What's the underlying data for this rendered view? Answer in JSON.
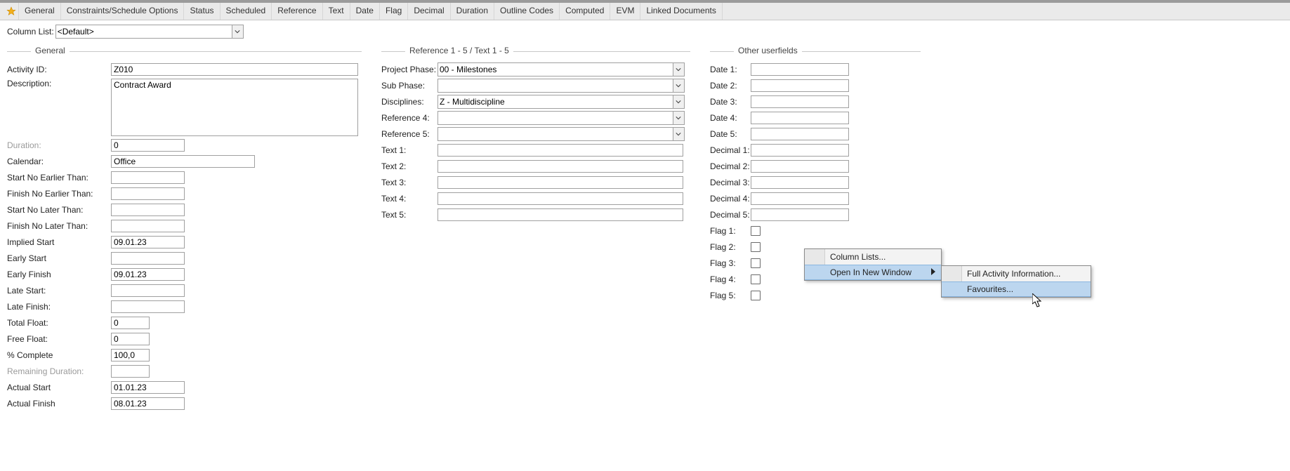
{
  "tabs": [
    "General",
    "Constraints/Schedule Options",
    "Status",
    "Scheduled",
    "Reference",
    "Text",
    "Date",
    "Flag",
    "Decimal",
    "Duration",
    "Outline Codes",
    "Computed",
    "EVM",
    "Linked Documents"
  ],
  "column_list": {
    "label": "Column List:",
    "value": "<Default>"
  },
  "sections": {
    "general": "General",
    "ref": "Reference 1 - 5 / Text 1 - 5",
    "other": "Other userfields"
  },
  "general": {
    "activity_id": {
      "label": "Activity ID:",
      "value": "Z010"
    },
    "description": {
      "label": "Description:",
      "value": "Contract Award"
    },
    "duration": {
      "label": "Duration:",
      "value": "0"
    },
    "calendar": {
      "label": "Calendar:",
      "value": "Office"
    },
    "snet": {
      "label": "Start No Earlier Than:",
      "value": ""
    },
    "fnet": {
      "label": "Finish No  Earlier Than:",
      "value": ""
    },
    "snlt": {
      "label": "Start No Later Than:",
      "value": ""
    },
    "fnlt": {
      "label": "Finish No Later Than:",
      "value": ""
    },
    "imps": {
      "label": "Implied Start",
      "value": "09.01.23"
    },
    "es": {
      "label": "Early Start",
      "value": ""
    },
    "ef": {
      "label": "Early Finish",
      "value": "09.01.23"
    },
    "ls": {
      "label": "Late Start:",
      "value": ""
    },
    "lf": {
      "label": "Late Finish:",
      "value": ""
    },
    "tf": {
      "label": "Total Float:",
      "value": "0"
    },
    "ff": {
      "label": "Free Float:",
      "value": "0"
    },
    "pct": {
      "label": "% Complete",
      "value": "100,0"
    },
    "remd": {
      "label": "Remaining Duration:",
      "value": ""
    },
    "as": {
      "label": "Actual Start",
      "value": "01.01.23"
    },
    "af": {
      "label": "Actual Finish",
      "value": "08.01.23"
    }
  },
  "ref": {
    "phase": {
      "label": "Project Phase:",
      "value": "00 - Milestones"
    },
    "sub": {
      "label": "Sub Phase:",
      "value": ""
    },
    "disc": {
      "label": "Disciplines:",
      "value": "Z - Multidiscipline"
    },
    "r4": {
      "label": "Reference 4:",
      "value": ""
    },
    "r5": {
      "label": "Reference 5:",
      "value": ""
    },
    "t1": {
      "label": "Text 1:",
      "value": ""
    },
    "t2": {
      "label": "Text 2:",
      "value": ""
    },
    "t3": {
      "label": "Text 3:",
      "value": ""
    },
    "t4": {
      "label": "Text 4:",
      "value": ""
    },
    "t5": {
      "label": "Text 5:",
      "value": ""
    }
  },
  "other": {
    "d1": {
      "label": "Date 1:",
      "value": ""
    },
    "d2": {
      "label": "Date 2:",
      "value": ""
    },
    "d3": {
      "label": "Date 3:",
      "value": ""
    },
    "d4": {
      "label": "Date 4:",
      "value": ""
    },
    "d5": {
      "label": "Date 5:",
      "value": ""
    },
    "de1": {
      "label": "Decimal 1:",
      "value": ""
    },
    "de2": {
      "label": "Decimal 2:",
      "value": ""
    },
    "de3": {
      "label": "Decimal 3:",
      "value": ""
    },
    "de4": {
      "label": "Decimal 4:",
      "value": ""
    },
    "de5": {
      "label": "Decimal 5:",
      "value": ""
    },
    "f1": {
      "label": "Flag 1:",
      "checked": false
    },
    "f2": {
      "label": "Flag 2:",
      "checked": false
    },
    "f3": {
      "label": "Flag 3:",
      "checked": false
    },
    "f4": {
      "label": "Flag 4:",
      "checked": false
    },
    "f5": {
      "label": "Flag 5:",
      "checked": false
    }
  },
  "context_menu": {
    "items": [
      {
        "label": "Column Lists...",
        "selected": false,
        "has_sub": false
      },
      {
        "label": "Open In New Window",
        "selected": true,
        "has_sub": true
      }
    ],
    "submenu": [
      {
        "label": "Full Activity Information...",
        "selected": false
      },
      {
        "label": "Favourites...",
        "selected": true
      }
    ]
  }
}
